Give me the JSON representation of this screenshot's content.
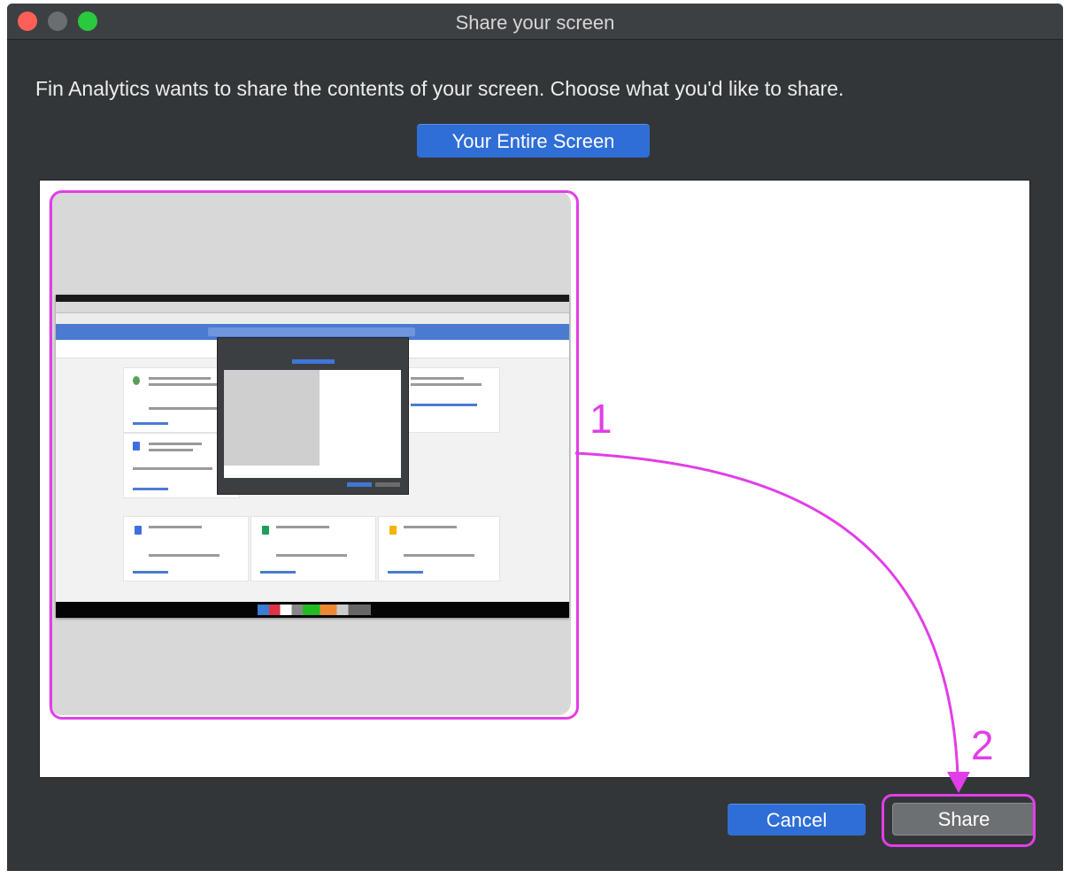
{
  "window": {
    "title": "Share your screen"
  },
  "prompt": "Fin Analytics wants to share the contents of your screen. Choose what you'd like to share.",
  "tabs": {
    "entire_screen_label": "Your Entire Screen"
  },
  "buttons": {
    "cancel_label": "Cancel",
    "share_label": "Share"
  },
  "annotations": {
    "step_1": "1",
    "step_2": "2",
    "highlight_color": "#e23ee8"
  },
  "colors": {
    "primary_button": "#2f6ed6",
    "window_background": "#323639"
  }
}
